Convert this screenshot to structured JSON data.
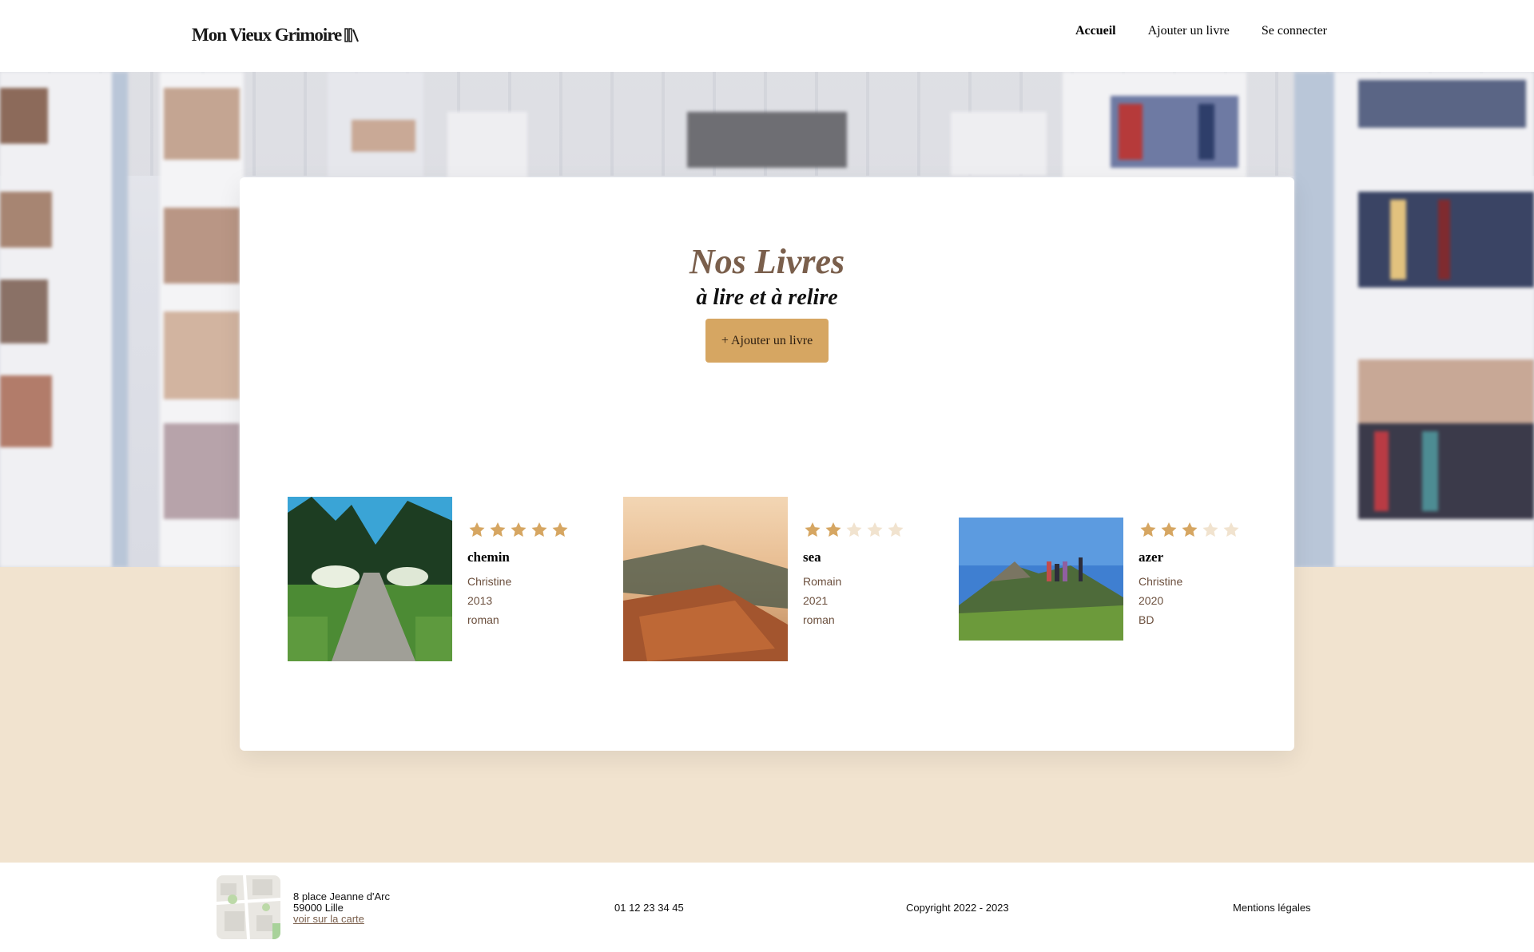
{
  "header": {
    "logo_text": "Mon Vieux Grimoire",
    "nav": [
      {
        "label": "Accueil",
        "active": true
      },
      {
        "label": "Ajouter un livre",
        "active": false
      },
      {
        "label": "Se connecter",
        "active": false
      }
    ]
  },
  "main": {
    "title": "Nos Livres",
    "subtitle": "à lire et à relire",
    "add_button": "+ Ajouter un livre",
    "books": [
      {
        "title": "chemin",
        "author": "Christine",
        "year": "2013",
        "genre": "roman",
        "rating": 5,
        "cover": "path-in-forest"
      },
      {
        "title": "sea",
        "author": "Romain",
        "year": "2021",
        "genre": "roman",
        "rating": 2,
        "cover": "sea-cliff-sunset"
      },
      {
        "title": "azer",
        "author": "Christine",
        "year": "2020",
        "genre": "BD",
        "rating": 3,
        "cover": "hikers-on-mountain"
      }
    ]
  },
  "footer": {
    "address_line1": "8 place Jeanne d'Arc",
    "address_line2": "59000 Lille",
    "map_link": "voir sur la carte",
    "phone": "01 12 23 34 45",
    "copyright": "Copyright 2022 - 2023",
    "legal": "Mentions légales"
  },
  "colors": {
    "accent": "#d6a662",
    "brown": "#7a5f4c",
    "beige": "#f1e3cf",
    "star_full": "#d6a662",
    "star_empty": "#f1e3cf"
  }
}
